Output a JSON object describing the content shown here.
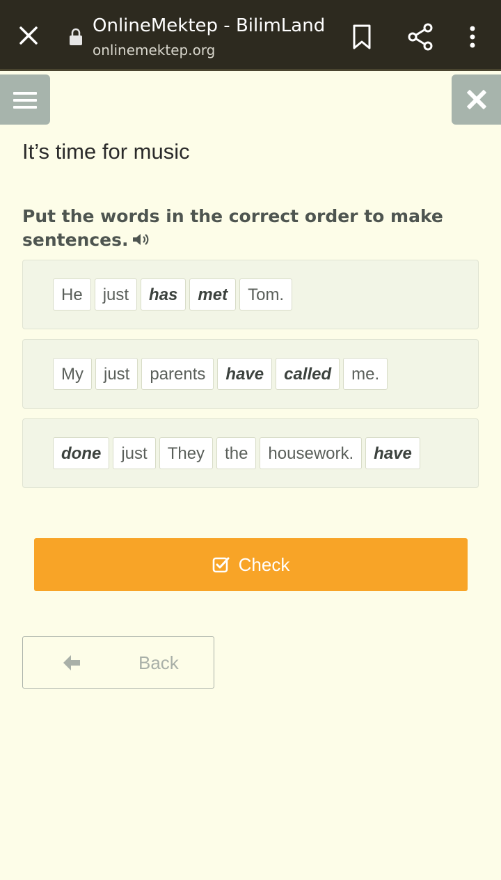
{
  "browser": {
    "title": "OnlineMektep - BilimLand",
    "url": "onlinemektep.org"
  },
  "page": {
    "title": "It’s time for music",
    "instruction": "Put the words in the correct order to make sentences."
  },
  "sentences": [
    {
      "words": [
        {
          "text": "He",
          "emphasis": false
        },
        {
          "text": "just",
          "emphasis": false
        },
        {
          "text": "has",
          "emphasis": true
        },
        {
          "text": "met",
          "emphasis": true
        },
        {
          "text": "Tom.",
          "emphasis": false
        }
      ]
    },
    {
      "words": [
        {
          "text": "My",
          "emphasis": false
        },
        {
          "text": "just",
          "emphasis": false
        },
        {
          "text": "parents",
          "emphasis": false
        },
        {
          "text": "have",
          "emphasis": true
        },
        {
          "text": "called",
          "emphasis": true
        },
        {
          "text": "me.",
          "emphasis": false
        }
      ]
    },
    {
      "words": [
        {
          "text": "done",
          "emphasis": true
        },
        {
          "text": "just",
          "emphasis": false
        },
        {
          "text": "They",
          "emphasis": false
        },
        {
          "text": "the",
          "emphasis": false
        },
        {
          "text": "housework.",
          "emphasis": false
        },
        {
          "text": "have",
          "emphasis": true
        }
      ]
    }
  ],
  "buttons": {
    "check": "Check",
    "back": "Back"
  },
  "colors": {
    "accent": "#f8a427",
    "topbar": "#2d2a1f",
    "side_button": "#a7b4ac",
    "background": "#fdfde8"
  }
}
